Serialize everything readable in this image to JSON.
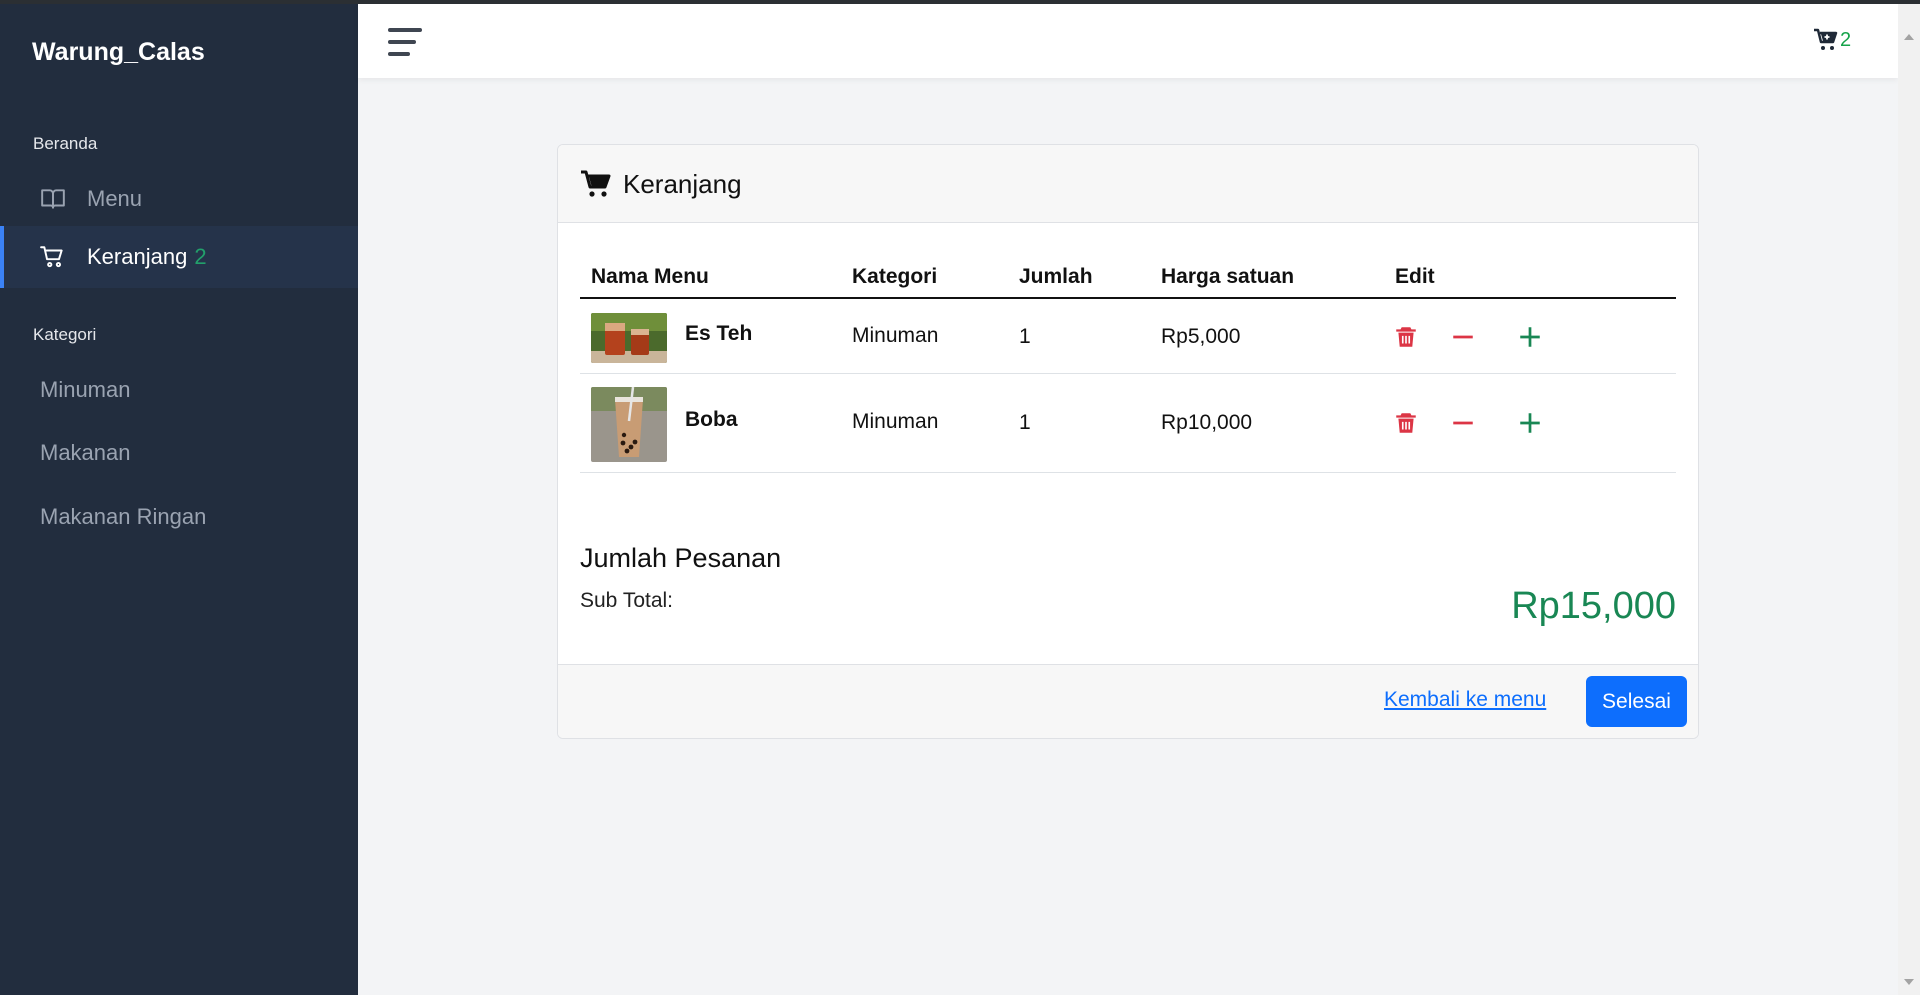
{
  "brand": "Warung_Calas",
  "sidebar": {
    "section_home": "Beranda",
    "menu_label": "Menu",
    "cart_label": "Keranjang",
    "cart_count": "2",
    "section_category": "Kategori",
    "categories": [
      "Minuman",
      "Makanan",
      "Makanan Ringan"
    ]
  },
  "topbar": {
    "cart_count": "2"
  },
  "card": {
    "title": "Keranjang",
    "headers": [
      "Nama Menu",
      "Kategori",
      "Jumlah",
      "Harga satuan",
      "Edit"
    ],
    "items": [
      {
        "name": "Es Teh",
        "category": "Minuman",
        "qty": "1",
        "price": "Rp5,000"
      },
      {
        "name": "Boba",
        "category": "Minuman",
        "qty": "1",
        "price": "Rp10,000"
      }
    ],
    "summary_title": "Jumlah Pesanan",
    "subtotal_label": "Sub Total:",
    "subtotal_value": "Rp15,000",
    "back_link": "Kembali ke menu",
    "finish_button": "Selesai"
  },
  "colors": {
    "sidebar_bg": "#222d3e",
    "accent_blue": "#0d6efd",
    "success_green": "#198754",
    "danger_red": "#dc3545"
  },
  "icons": {
    "menu": "book-icon",
    "cart": "cart-icon",
    "delete": "trash-icon",
    "decrease": "minus-icon",
    "increase": "plus-icon",
    "toggle": "hamburger-icon"
  }
}
